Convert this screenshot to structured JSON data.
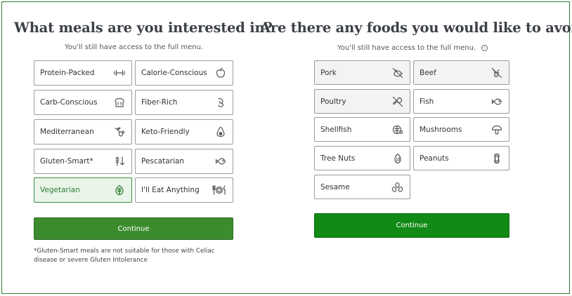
{
  "left": {
    "title": "What meals are you interested in?",
    "subtitle": "You'll still have access to the full menu.",
    "options": [
      {
        "label": "Protein-Packed",
        "icon": "dumbbell-icon"
      },
      {
        "label": "Calorie-Conscious",
        "icon": "apple-icon"
      },
      {
        "label": "Carb-Conscious",
        "icon": "bread-icon"
      },
      {
        "label": "Fiber-Rich",
        "icon": "fiber-swirl-icon"
      },
      {
        "label": "Mediterranean",
        "icon": "olive-branch-icon"
      },
      {
        "label": "Keto-Friendly",
        "icon": "avocado-icon"
      },
      {
        "label": "Gluten-Smart*",
        "icon": "wheat-arrow-icon"
      },
      {
        "label": "Pescatarian",
        "icon": "fish-icon"
      },
      {
        "label": "Vegetarian",
        "icon": "leaf-icon",
        "selected": true
      },
      {
        "label": "I'll Eat Anything",
        "icon": "fork-plate-knife-icon"
      }
    ],
    "continue_label": "Continue",
    "footnote": "*Gluten-Smart meals are not suitable for those with Celiac disease or severe Gluten Intolerance"
  },
  "right": {
    "title": "Are there any foods you would like to avoid?",
    "subtitle": "You'll still have access to the full menu.",
    "options": [
      {
        "label": "Pork",
        "icon": "no-pork-icon",
        "selected": true
      },
      {
        "label": "Beef",
        "icon": "no-beef-icon",
        "selected": true
      },
      {
        "label": "Poultry",
        "icon": "no-poultry-icon",
        "selected": true
      },
      {
        "label": "Fish",
        "icon": "fish-icon"
      },
      {
        "label": "Shellfish",
        "icon": "shellfish-icon"
      },
      {
        "label": "Mushrooms",
        "icon": "mushroom-icon"
      },
      {
        "label": "Tree Nuts",
        "icon": "almond-icon"
      },
      {
        "label": "Peanuts",
        "icon": "peanut-icon"
      },
      {
        "label": "Sesame",
        "icon": "sesame-icon"
      }
    ],
    "continue_label": "Continue"
  },
  "colors": {
    "selected_bg": "#eaf5ea",
    "selected_border": "#388e3c",
    "button_left": "#3c8c2f",
    "button_right": "#118a16",
    "frame": "#2e7d32"
  }
}
